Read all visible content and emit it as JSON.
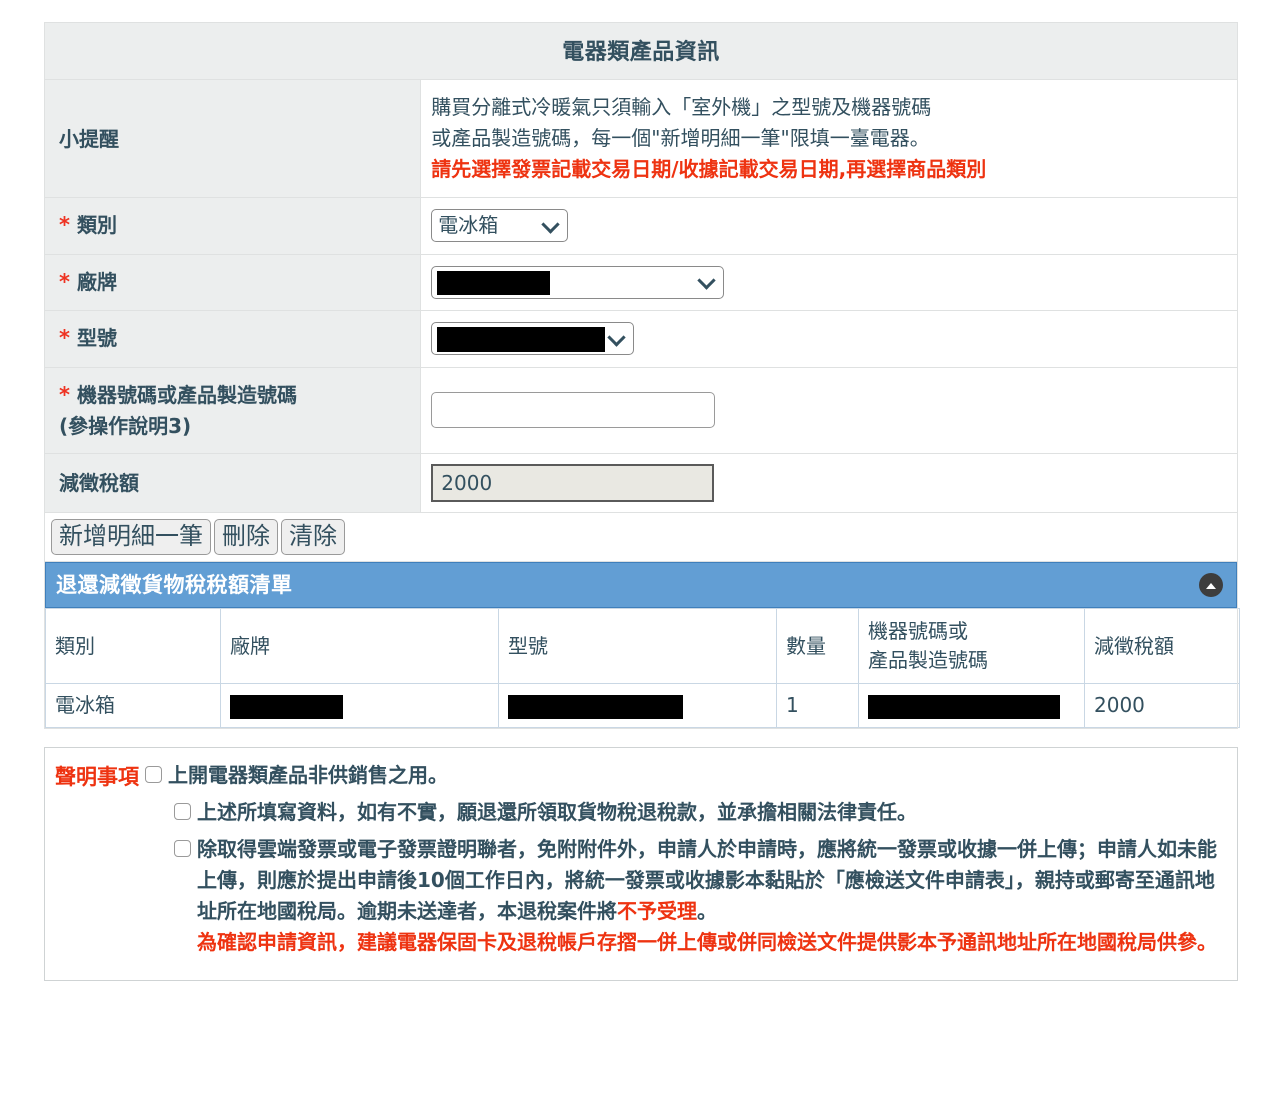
{
  "form": {
    "title": "電器類產品資訊",
    "rows": {
      "hint_label": "小提醒",
      "hint_line1": "購買分離式冷暖氣只須輸入「室外機」之型號及機器號碼",
      "hint_line2": "或產品製造號碼，每一個\"新增明細一筆\"限填一臺電器。",
      "hint_warning": "請先選擇發票記載交易日期/收據記載交易日期,再選擇商品類別",
      "category_label": "類別",
      "category_value": "電冰箱",
      "brand_label": "廠牌",
      "brand_value": "",
      "model_label": "型號",
      "model_value": "",
      "serial_label_line1": "機器號碼或產品製造號碼",
      "serial_label_line2": "(參操作說明3)",
      "serial_value": "",
      "tax_label": "減徵稅額",
      "tax_value": "2000"
    },
    "required_mark": "*"
  },
  "buttons": {
    "add": "新增明細一筆",
    "delete": "刪除",
    "clear": "清除"
  },
  "panel": {
    "title": "退還減徵貨物稅稅額清單",
    "toggle_icon": "chevron-up-circle-icon"
  },
  "list": {
    "headers": {
      "category": "類別",
      "brand": "廠牌",
      "model": "型號",
      "qty": "數量",
      "serial_line1": "機器號碼或",
      "serial_line2": "產品製造號碼",
      "tax": "減徵稅額"
    },
    "rows": [
      {
        "category": "電冰箱",
        "brand": "",
        "model": "",
        "qty": "1",
        "serial": "",
        "tax": "2000"
      }
    ]
  },
  "declaration": {
    "title": "聲明事項",
    "item1": "上開電器類產品非供銷售之用。",
    "item2": "上述所填寫資料，如有不實，願退還所領取貨物稅退稅款，並承擔相關法律責任。",
    "item3_part1": "除取得雲端發票或電子發票證明聯者，免附附件外，申請人於申請時，應將統一發票或收據一併上傳；申請人如未能上傳，則應於提出申請後10個工作日內，將統一發票或收據影本黏貼於「應檢送文件申請表」，親持或郵寄至通訊地址所在地國稅局。逾期未送達者，本退稅案件將",
    "item3_red": "不予受理",
    "item3_part2": "。",
    "item3_note": "為確認申請資訊，建議電器保固卡及退稅帳戶存摺一併上傳或併同檢送文件提供影本予通訊地址所在地國稅局供參。"
  },
  "colors": {
    "panel_blue": "#629ed4",
    "label_bg": "#eceeee",
    "text": "#33505f",
    "warning_red": "#ee3311"
  }
}
